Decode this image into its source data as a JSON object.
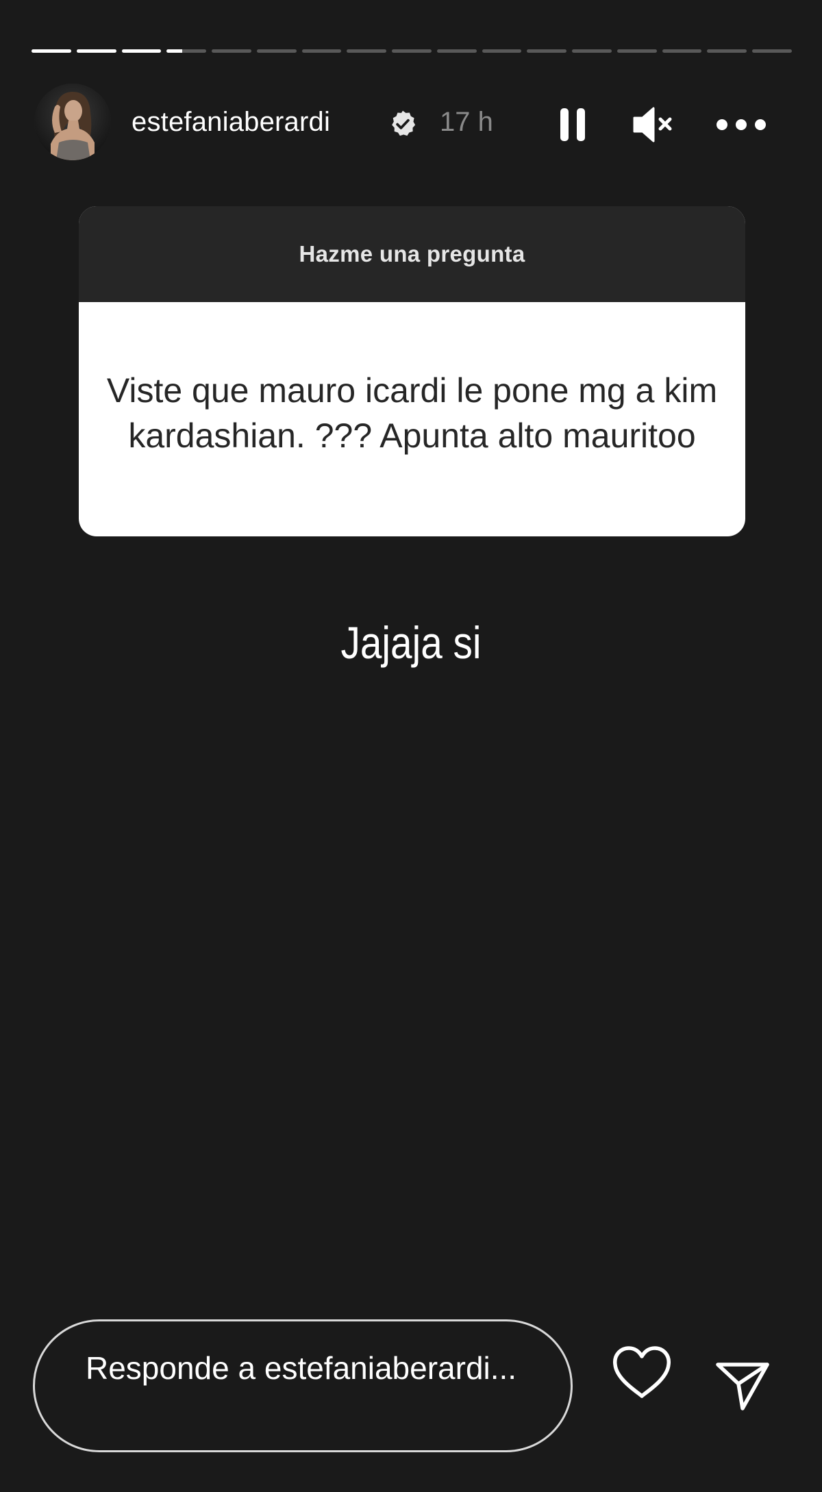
{
  "story": {
    "progress_segments_total": 17,
    "progress_segments_completed": 3,
    "progress_current_fraction": 0.4
  },
  "header": {
    "username": "estefaniaberardi",
    "verified_icon": "verified-badge-icon",
    "time": "17 h",
    "pause_icon": "pause-icon",
    "mute_icon": "muted-speaker-icon",
    "more_icon": "more-options-icon"
  },
  "question_sticker": {
    "title": "Hazme una pregunta",
    "question": "Viste que mauro icardi le pone mg a kim kardashian. ??? Apunta alto mauritoo"
  },
  "answer_text": "Jajaja si",
  "reply": {
    "placeholder": "Responde a estefaniaberardi...",
    "heart_icon": "heart-icon",
    "send_icon": "send-icon"
  },
  "colors": {
    "background": "#1a1a1a",
    "sticker_header": "#262626",
    "sticker_body": "#ffffff",
    "time_text": "#8a8a8a"
  }
}
